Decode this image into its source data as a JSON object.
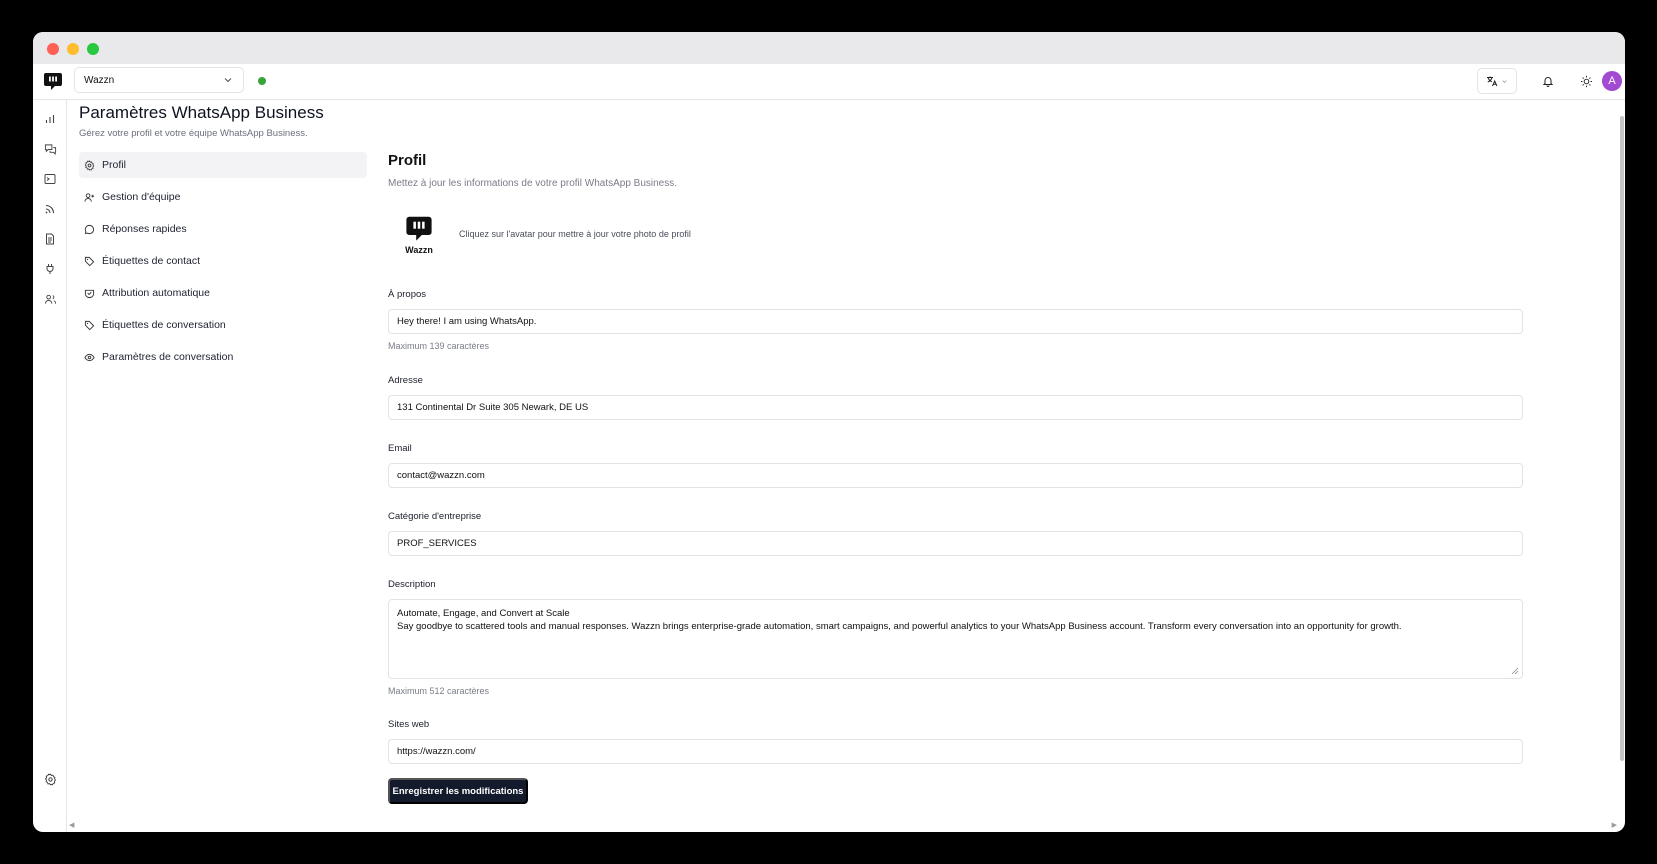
{
  "workspace": {
    "selected": "Wazzn"
  },
  "user": {
    "avatar_initial": "A"
  },
  "page": {
    "title": "Paramètres WhatsApp Business",
    "subtitle": "Gérez votre profil et votre équipe WhatsApp Business."
  },
  "subnav": {
    "items": [
      {
        "label": "Profil",
        "icon": "gear-icon",
        "active": true
      },
      {
        "label": "Gestion d'équipe",
        "icon": "user-plus-icon"
      },
      {
        "label": "Réponses rapides",
        "icon": "chat-bubble-icon"
      },
      {
        "label": "Étiquettes de contact",
        "icon": "tag-icon"
      },
      {
        "label": "Attribution automatique",
        "icon": "shield-check-icon"
      },
      {
        "label": "Étiquettes de conversation",
        "icon": "tag-icon"
      },
      {
        "label": "Paramètres de conversation",
        "icon": "eye-icon"
      }
    ]
  },
  "rail": {
    "icons": [
      "bar-chart-icon",
      "messages-icon",
      "terminal-icon",
      "rss-icon",
      "document-icon",
      "plug-icon",
      "users-icon"
    ],
    "bottom_icon": "settings-icon"
  },
  "profile": {
    "title": "Profil",
    "description": "Mettez à jour les informations de votre profil WhatsApp Business.",
    "avatar_name": "Wazzn",
    "avatar_hint": "Cliquez sur l'avatar pour mettre à jour votre photo de profil",
    "about": {
      "label": "À propos",
      "value": "Hey there! I am using WhatsApp.",
      "helper": "Maximum 139 caractères"
    },
    "address": {
      "label": "Adresse",
      "value": "131 Continental Dr  Suite 305  Newark, DE US"
    },
    "email": {
      "label": "Email",
      "value": "contact@wazzn.com"
    },
    "category": {
      "label": "Catégorie d'entreprise",
      "value": "PROF_SERVICES"
    },
    "description_field": {
      "label": "Description",
      "line1": "Automate, Engage, and Convert at Scale",
      "line2": "Say goodbye to scattered tools and manual responses. Wazzn brings enterprise-grade automation, smart campaigns, and powerful analytics to your WhatsApp Business account. Transform every conversation into an opportunity for growth.",
      "helper": "Maximum 512 caractères"
    },
    "websites": {
      "label": "Sites web",
      "value": "https://wazzn.com/"
    },
    "save_label": "Enregistrer les modifications"
  },
  "colors": {
    "primary_button": "#131a2c",
    "status_online": "#38a53a",
    "avatar_bg": "#a24ad1"
  }
}
